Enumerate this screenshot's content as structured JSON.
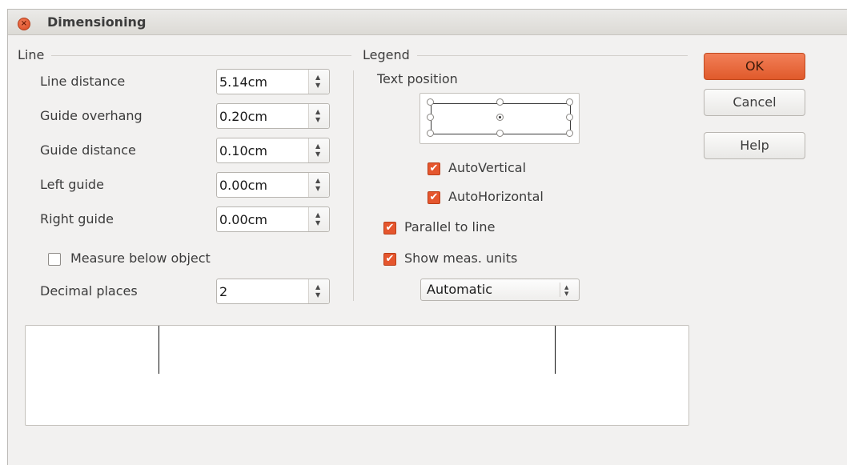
{
  "window": {
    "title": "Dimensioning",
    "close_glyph": "×"
  },
  "line_section": {
    "label": "Line",
    "fields": [
      {
        "label": "Line distance",
        "value": "5.14cm"
      },
      {
        "label": "Guide overhang",
        "value": "0.20cm"
      },
      {
        "label": "Guide distance",
        "value": "0.10cm"
      },
      {
        "label": "Left guide",
        "value": "0.00cm"
      },
      {
        "label": "Right guide",
        "value": "0.00cm"
      }
    ],
    "measure_below": {
      "label": "Measure below object",
      "checked": false
    },
    "decimal_places": {
      "label": "Decimal places",
      "value": "2"
    }
  },
  "legend_section": {
    "label": "Legend",
    "text_position_label": "Text position",
    "auto_vertical": {
      "label": "AutoVertical",
      "checked": true
    },
    "auto_horizontal": {
      "label": "AutoHorizontal",
      "checked": true
    },
    "parallel_to_line": {
      "label": "Parallel to line",
      "checked": true
    },
    "show_units": {
      "label": "Show meas. units",
      "checked": true
    },
    "units_select": {
      "value": "Automatic"
    }
  },
  "buttons": {
    "ok": "OK",
    "cancel": "Cancel",
    "help": "Help"
  },
  "icons": {
    "checkmark": "check-icon",
    "spin_up": "▲",
    "spin_down": "▼"
  },
  "colors": {
    "accent": "#e5562e",
    "primary_button": "#e8633a",
    "dialog_bg": "#f2f1f0"
  }
}
